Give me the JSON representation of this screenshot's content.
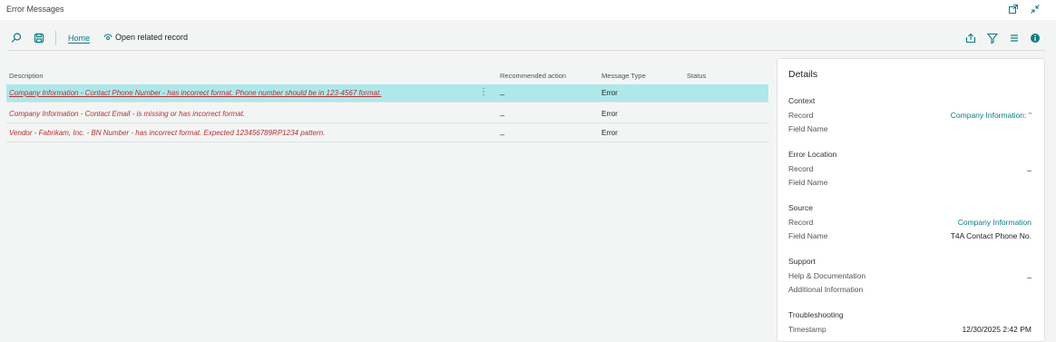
{
  "window": {
    "title": "Error Messages"
  },
  "icons": {
    "popout": "popout-icon",
    "collapse": "collapse-icon",
    "search": "search-icon",
    "save_view": "save-view-icon",
    "open_related": "link-icon",
    "share": "share-icon",
    "filter": "filter-icon",
    "list": "list-icon",
    "info": "info-icon"
  },
  "actions": {
    "home": "Home",
    "open_related": "Open related record"
  },
  "grid": {
    "columns": [
      "Description",
      "Recommended action",
      "Message Type",
      "Status"
    ],
    "rows": [
      {
        "description": "Company Information - Contact Phone Number - has incorrect format. Phone number should be in 123-4567 format.",
        "recommended_action": "_",
        "message_type": "Error",
        "status": "",
        "selected": true
      },
      {
        "description": "Company Information - Contact Email - is missing or has incorrect format.",
        "recommended_action": "_",
        "message_type": "Error",
        "status": "",
        "selected": false
      },
      {
        "description": "Vendor - Fabrikam, Inc. - BN Number - has incorrect format. Expected 123456789RP1234 pattern.",
        "recommended_action": "_",
        "message_type": "Error",
        "status": "",
        "selected": false
      }
    ]
  },
  "details": {
    "title": "Details",
    "context": {
      "heading": "Context",
      "record_label": "Record",
      "record_value": "Company Information: ''",
      "field_label": "Field Name",
      "field_value": ""
    },
    "error_location": {
      "heading": "Error Location",
      "record_label": "Record",
      "record_value": "_",
      "field_label": "Field Name",
      "field_value": ""
    },
    "source": {
      "heading": "Source",
      "record_label": "Record",
      "record_value": "Company Information",
      "field_label": "Field Name",
      "field_value": "T4A Contact Phone No."
    },
    "support": {
      "heading": "Support",
      "help_label": "Help & Documentation",
      "help_value": "_",
      "additional_label": "Additional Information",
      "additional_value": ""
    },
    "troubleshooting": {
      "heading": "Troubleshooting",
      "timestamp_label": "Timestamp",
      "timestamp_value": "12/30/2025 2:42 PM"
    }
  },
  "colors": {
    "accent": "#0e7c86",
    "error_text": "#b43237",
    "selected_row": "#aee8ea",
    "background": "#f3f5f4"
  }
}
